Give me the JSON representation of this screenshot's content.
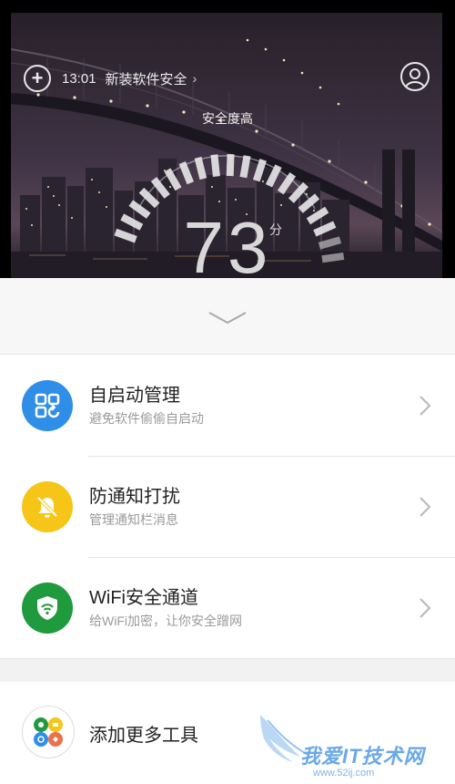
{
  "header": {
    "time": "13:01",
    "news_text": "新装软件安全",
    "news_arrow": "›",
    "safety_label": "安全度高",
    "score": "73",
    "score_unit": "分"
  },
  "icons": {
    "add": "plus-circle-icon",
    "avatar": "user-avatar-icon",
    "pull_down": "chevron-down-icon"
  },
  "tools": [
    {
      "title": "自启动管理",
      "subtitle": "避免软件偷偷自启动",
      "color": "#2f8ee8",
      "icon": "app-grid-icon"
    },
    {
      "title": "防通知打扰",
      "subtitle": "管理通知栏消息",
      "color": "#f5c518",
      "icon": "bell-off-icon"
    },
    {
      "title": "WiFi安全通道",
      "subtitle": "给WiFi加密，让你安全蹭网",
      "color": "#1f9a3c",
      "icon": "wifi-shield-icon"
    }
  ],
  "more_tools": {
    "label": "添加更多工具"
  },
  "watermark": {
    "text": "我爱IT技术网",
    "url": "www.52ij.com"
  }
}
